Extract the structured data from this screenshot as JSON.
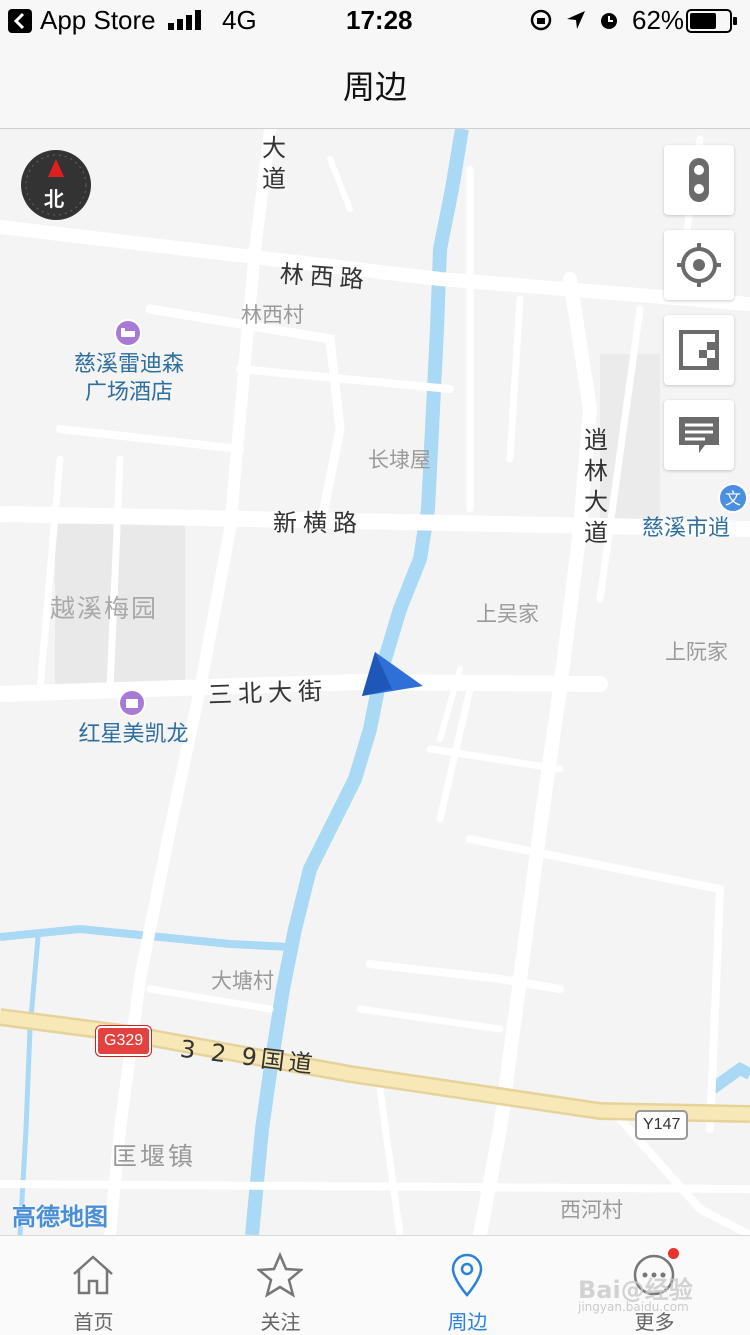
{
  "status_bar": {
    "back_label": "App Store",
    "network": "4G",
    "time": "17:28",
    "battery": "62%"
  },
  "header": {
    "title": "周边"
  },
  "map": {
    "compass_label": "北",
    "roads": {
      "linxi": "林西路",
      "xinheng": "新横路",
      "sanbei": "三北大街",
      "g329": "3 2 9国道",
      "dadao_top": "大道",
      "xiaolin": "逍林大道"
    },
    "places": {
      "linxi_cun": "林西村",
      "changlu_wu": "长埭屋",
      "shangwu_jia": "上吴家",
      "shangruan_jia": "上阮家",
      "datang_cun": "大塘村",
      "kuangyan_zhen": "匡堰镇",
      "xihe_cun": "西河村",
      "yuexi_meiyuan": "越溪梅园"
    },
    "pois": {
      "hotel": "慈溪雷迪森\n广场酒店",
      "mall": "红星美凯龙",
      "culture": "慈溪市逍"
    },
    "shields": {
      "g329": "G329",
      "y147": "Y147"
    },
    "logo": "高德地图",
    "colors": {
      "water": "#a9d9f5",
      "highway": "#f8e8b8",
      "accent": "#2a82d9",
      "arrow": "#2f6fd8"
    }
  },
  "map_controls": [
    {
      "icon": "traffic-light-icon"
    },
    {
      "icon": "locate-icon"
    },
    {
      "icon": "layers-icon"
    },
    {
      "icon": "message-icon"
    }
  ],
  "tabs": [
    {
      "label": "首页",
      "icon": "home-icon",
      "active": false
    },
    {
      "label": "关注",
      "icon": "star-icon",
      "active": false
    },
    {
      "label": "周边",
      "icon": "location-pin-icon",
      "active": true
    },
    {
      "label": "更多",
      "icon": "more-icon",
      "active": false
    }
  ],
  "watermark": {
    "main": "Bai@经验",
    "sub": "jingyan.baidu.com"
  }
}
